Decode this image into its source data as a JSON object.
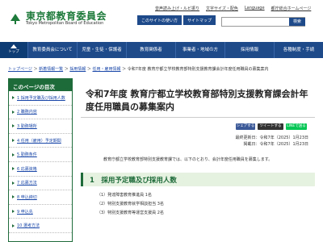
{
  "header": {
    "logo_name": "東京都教育委員会",
    "logo_sub": "Tokyo Metropolitan Board of Education",
    "util_links": [
      "音声読み上げ・ルビ振り",
      "文字サイズ・配色",
      "Language",
      "都庁総合ホームページ"
    ],
    "site_buttons": [
      "このサイトの使い方",
      "サイトマップ"
    ],
    "search_placeholder": "",
    "search_button": "検索"
  },
  "nav": {
    "home_label": "トップ",
    "items": [
      "教育委員会について",
      "児童・生徒・保護者",
      "教育関係者",
      "事業者・地域の方",
      "採用情報",
      "各種制度・手続"
    ]
  },
  "breadcrumb": {
    "items": [
      "トップページ",
      "新着情報一覧",
      "採用情報",
      "任用・雇用情報"
    ],
    "current": "令和7年度 教育庁都立学校教育部特別支援教育課会計年度任用職員の募集案内"
  },
  "sidebar": {
    "title": "このページの目次",
    "items": [
      "1 採用予定職及び採用人数",
      "2 職務内容",
      "3 勤務場所",
      "4 任用（雇用）予定期間",
      "5 勤務条件",
      "6 応募資格",
      "7 応募方法",
      "8 申込締切",
      "9 申込先",
      "10 選考方法"
    ]
  },
  "main": {
    "title": "令和7年度 教育庁都立学校教育部特別支援教育課会計年度任用職員の募集案内",
    "share": {
      "facebook": "シェアする",
      "x": "ツイートする",
      "line": "LINEで送る"
    },
    "date_updated": "最終更新日：令和7年（2025）1月23日",
    "date_posted": "掲載日：令和7年（2025）1月23日",
    "intro": "教育庁都立学校教育部特別支援教育課では、以下のとおり、会計年度任用職員を募集します。",
    "section_heading": "1　採用予定職及び採用人数",
    "positions": [
      "（1）発達障害教育推進員 1名",
      "（2）特別支援教育就学相談担当 3名",
      "（3）特別支援教育等運営支援員 2名"
    ]
  },
  "colors": {
    "nav": "#1e4a8a",
    "brand_green": "#1e6b3a",
    "section_bg": "#e6f2e0"
  }
}
